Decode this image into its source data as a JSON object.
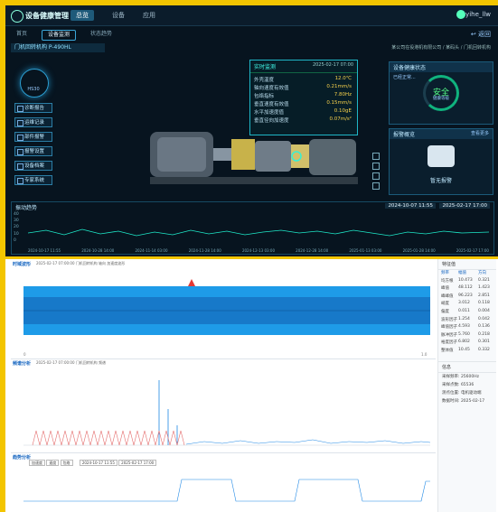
{
  "header": {
    "app_title": "设备健康管理",
    "nav": [
      "总览",
      "设备",
      "应用"
    ],
    "user": "yihe_llw"
  },
  "subtabs": [
    "首页",
    "设备监测",
    "状态趋势"
  ],
  "back_label": "返回",
  "device_label": "门机回转机构 P-490HL",
  "device_path": "某公司在役港机有限公司 / 某码头 / 门机回转机构",
  "radar_label": "HS30",
  "left_menu": [
    "诊断报告",
    "运维记录",
    "部件报警",
    "报警设置",
    "设备档案",
    "专家系统"
  ],
  "info": {
    "title": "实时监测",
    "timestamp": "2025-02-17 07:00",
    "rows": [
      {
        "label": "外壳温度",
        "value": "12.0℃"
      },
      {
        "label": "轴向速度有效值",
        "value": "0.21mm/s"
      },
      {
        "label": "包络指标",
        "value": "7.80Hz"
      },
      {
        "label": "垂直速度有效值",
        "value": "0.15mm/s"
      },
      {
        "label": "水平加速度值",
        "value": "0.10gE"
      },
      {
        "label": "垂直径向加速度",
        "value": "0.07m/s²"
      }
    ]
  },
  "right_panels": {
    "health_title": "设备健康状态",
    "health_sub": "已经正常...",
    "gauge_value": "安全",
    "gauge_sub": "健康等级",
    "alarm_title": "报警概览",
    "alarm_link": "查看更多",
    "alarm_status": "暂无报警"
  },
  "trend": {
    "title": "振动趋势",
    "date_start": "2024-10-07 11:55",
    "date_end": "2025-02-17 17:00",
    "yticks": [
      "40",
      "30",
      "20",
      "10",
      "0"
    ],
    "xticks": [
      "2024-10-17 11:55",
      "2024-10-28 14:00",
      "2024-11-14 03:00",
      "2024-11-28 14:00",
      "2024-12-13 03:00",
      "2024-12-28 14:00",
      "2025-01-13 03:00",
      "2025-01-28 14:00",
      "2025-02-17 17:00"
    ]
  },
  "waveform": {
    "title": "时域波形",
    "caption": "2025-02-17 07:00:00 门机回转机构 轴向 加速度波形",
    "xlabel_left": "0",
    "xlabel_right": "1.0"
  },
  "spectrum": {
    "title": "频谱分析",
    "caption": "2025-02-17 07:00:00 门机回转机构 频谱"
  },
  "trendlow": {
    "title": "趋势分析",
    "tabs": [
      "加速度",
      "速度",
      "包络"
    ],
    "range_start": "2024-10-17 11:55",
    "range_end": "2025-02-17 17:00"
  },
  "sidebar": {
    "header": "特征值",
    "meta": [
      "频率",
      "幅值",
      "方向"
    ],
    "rows": [
      {
        "k": "均方根",
        "v1": "10.473",
        "v2": "0.321"
      },
      {
        "k": "峰值",
        "v1": "48.112",
        "v2": "1.423"
      },
      {
        "k": "峰峰值",
        "v1": "96.223",
        "v2": "2.851"
      },
      {
        "k": "峭度",
        "v1": "3.012",
        "v2": "0.118"
      },
      {
        "k": "偏度",
        "v1": "0.011",
        "v2": "0.004"
      },
      {
        "k": "波形因子",
        "v1": "1.254",
        "v2": "0.042"
      },
      {
        "k": "峰值因子",
        "v1": "4.593",
        "v2": "0.136"
      },
      {
        "k": "脉冲因子",
        "v1": "5.760",
        "v2": "0.218"
      },
      {
        "k": "裕度因子",
        "v1": "6.802",
        "v2": "0.301"
      },
      {
        "k": "整体值",
        "v1": "10.45",
        "v2": "0.332"
      }
    ],
    "info_header": "信息",
    "info": [
      "采样频率: 25600Hz",
      "采样点数: 65536",
      "测点位置: 电机驱动端",
      "数据时间: 2025-02-17"
    ]
  }
}
